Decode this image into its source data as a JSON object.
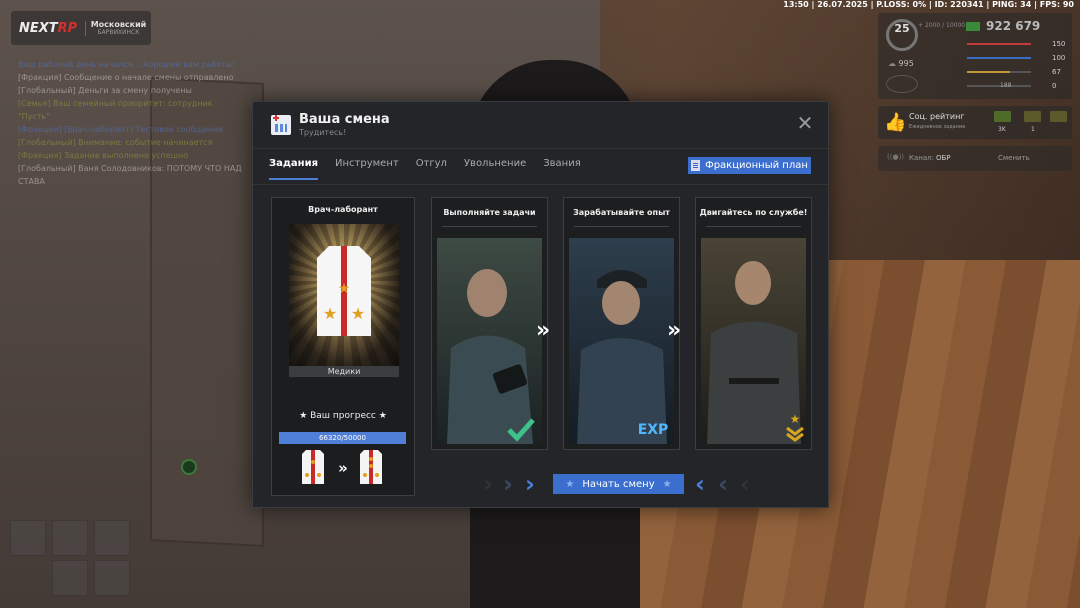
{
  "top_status": "13:50 | 26.07.2025 | P.LOSS: 0% | ID: 220341 | PING: 34 | FPS: 90",
  "logo": {
    "left": "NEXT",
    "right": "RP"
  },
  "server": {
    "name": "Московский",
    "sub": "БАРВИХИНСК"
  },
  "chat": [
    "Ваш рабочий день начался... Хорошей вам работы!",
    "[Фракция] Сообщение о начале смены отправлено",
    "[Глобальный] Деньги за смену получены",
    "[Семья] Ваш семейный приоритет: сотрудник",
    "\"Пусть\"",
    "[Фракция] [Врач-лаборант] Тестовое сообщение",
    "[Глобальный] Внимание: событие начинается",
    "[Фракция] Задание выполнено успешно",
    "[Глобальный] Ваня Солодовников: ПОТОМУ ЧТО НАД",
    "СТАВА"
  ],
  "hud": {
    "level": "25",
    "money": "922 679",
    "level_sub": "+ 2000 / 10000",
    "coins": "995",
    "stats": [
      {
        "value": "150"
      },
      {
        "value": "100"
      },
      {
        "value": "67"
      },
      {
        "value": "0"
      }
    ],
    "bottom_value": "188",
    "social_title": "Соц. рейтинг",
    "social_sub": "Ежедневное задание",
    "social_a": "3K",
    "social_b": "1",
    "channel_label": "Канал:",
    "channel_value": "ОБР",
    "channel_action": "Сменить"
  },
  "modal": {
    "title": "Ваша смена",
    "subtitle": "Трудитесь!",
    "tabs": [
      "Задания",
      "Инструмент",
      "Отгул",
      "Увольнение",
      "Звания"
    ],
    "plan_button": "Фракционный план",
    "rank": {
      "title": "Врач-лаборант",
      "faction": "Медики",
      "progress_label": "★ Ваш прогресс ★",
      "progress_current": 66320,
      "progress_max": 50000,
      "progress_text": "66320/50000"
    },
    "steps": [
      {
        "title": "Выполняйте задачи",
        "badge": "check"
      },
      {
        "title": "Зарабатывайте опыт",
        "badge": "EXP"
      },
      {
        "title": "Двигайтесь по службе!",
        "badge": "rank"
      }
    ],
    "start_button": "Начать смену"
  },
  "colors": {
    "accent": "#3c6fcd",
    "panel": "#232528",
    "card": "#1d1e20"
  }
}
